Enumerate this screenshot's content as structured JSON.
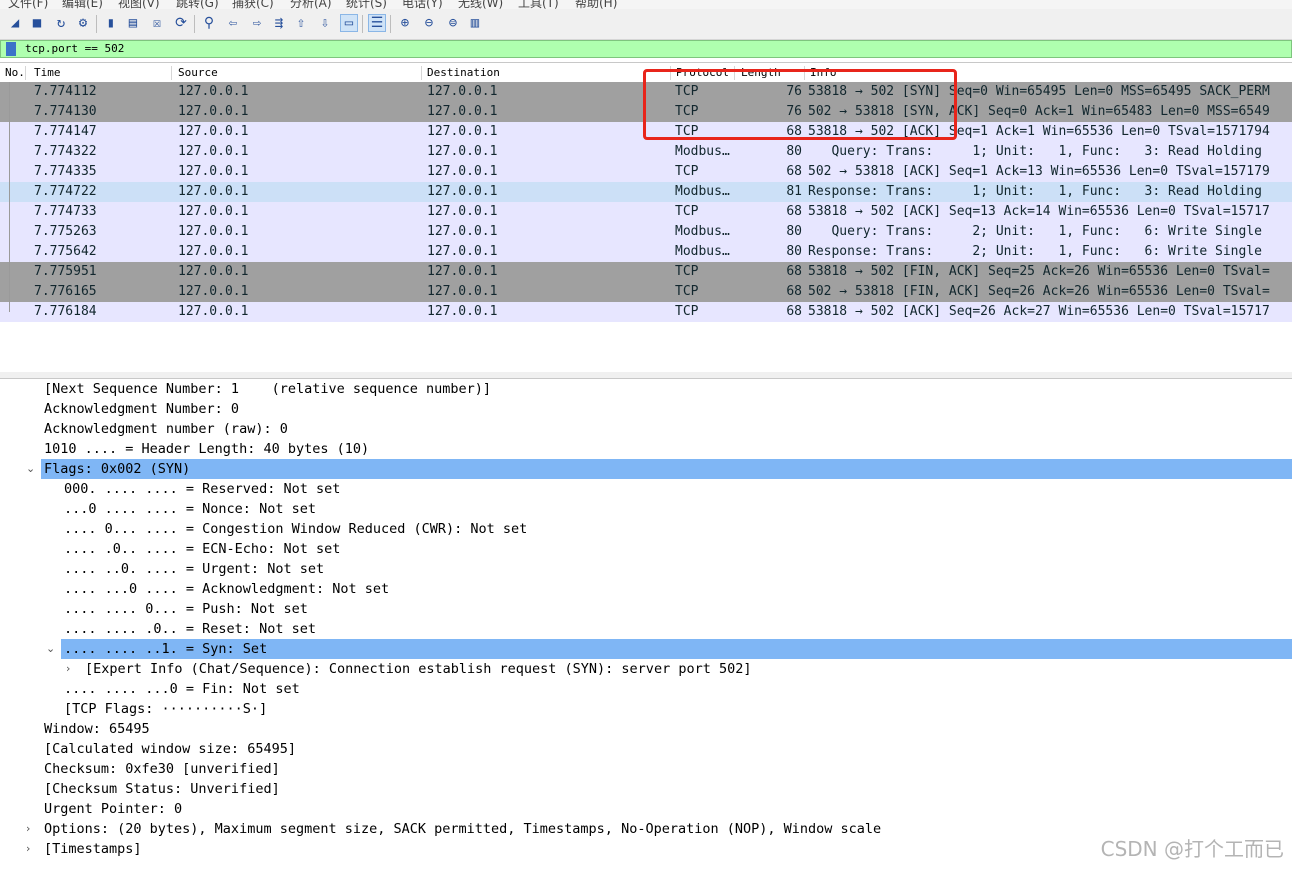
{
  "menu": [
    "文件(F)",
    "编辑(E)",
    "视图(V)",
    "跳转(G)",
    "捕获(C)",
    "分析(A)",
    "统计(S)",
    "电话(Y)",
    "无线(W)",
    "工具(T)",
    "帮助(H)"
  ],
  "toolbar": {
    "icons": [
      "shark-fin-start-icon",
      "stop-icon",
      "restart-icon",
      "options-gear-icon",
      "open-file-icon",
      "save-file-icon",
      "close-file-icon",
      "reload-icon",
      "find-icon",
      "back-arrow-icon",
      "forward-arrow-icon",
      "goto-packet-icon",
      "first-packet-icon",
      "last-packet-icon",
      "autoscroll-icon",
      "colorize-icon",
      "zoom-in-icon",
      "zoom-out-icon",
      "zoom-reset-icon",
      "resize-columns-icon"
    ]
  },
  "filter": {
    "value": "tcp.port == 502",
    "color": "#afffaf"
  },
  "packet_list": {
    "columns": [
      "No.",
      "Time",
      "Source",
      "Destination",
      "Protocol",
      "Length",
      "Info"
    ],
    "rows": [
      {
        "no": "",
        "time": "7.774112",
        "src": "127.0.0.1",
        "dst": "127.0.0.1",
        "proto": "TCP",
        "len": "76",
        "info": "53818 → 502 [SYN] Seq=0 Win=65495 Len=0 MSS=65495 SACK_PERM",
        "bg": "#a0a0a0"
      },
      {
        "no": "",
        "time": "7.774130",
        "src": "127.0.0.1",
        "dst": "127.0.0.1",
        "proto": "TCP",
        "len": "76",
        "info": "502 → 53818 [SYN, ACK] Seq=0 Ack=1 Win=65483 Len=0 MSS=6549",
        "bg": "#a0a0a0"
      },
      {
        "no": "",
        "time": "7.774147",
        "src": "127.0.0.1",
        "dst": "127.0.0.1",
        "proto": "TCP",
        "len": "68",
        "info": "53818 → 502 [ACK] Seq=1 Ack=1 Win=65536 Len=0 TSval=1571794",
        "bg": "#e7e6ff"
      },
      {
        "no": "",
        "time": "7.774322",
        "src": "127.0.0.1",
        "dst": "127.0.0.1",
        "proto": "Modbus…",
        "len": "80",
        "info": "   Query: Trans:     1; Unit:   1, Func:   3: Read Holding",
        "bg": "#e7e6ff"
      },
      {
        "no": "",
        "time": "7.774335",
        "src": "127.0.0.1",
        "dst": "127.0.0.1",
        "proto": "TCP",
        "len": "68",
        "info": "502 → 53818 [ACK] Seq=1 Ack=13 Win=65536 Len=0 TSval=157179",
        "bg": "#e7e6ff"
      },
      {
        "no": "",
        "time": "7.774722",
        "src": "127.0.0.1",
        "dst": "127.0.0.1",
        "proto": "Modbus…",
        "len": "81",
        "info": "Response: Trans:     1; Unit:   1, Func:   3: Read Holding",
        "bg": "#cce0f7"
      },
      {
        "no": "",
        "time": "7.774733",
        "src": "127.0.0.1",
        "dst": "127.0.0.1",
        "proto": "TCP",
        "len": "68",
        "info": "53818 → 502 [ACK] Seq=13 Ack=14 Win=65536 Len=0 TSval=15717",
        "bg": "#e7e6ff"
      },
      {
        "no": "",
        "time": "7.775263",
        "src": "127.0.0.1",
        "dst": "127.0.0.1",
        "proto": "Modbus…",
        "len": "80",
        "info": "   Query: Trans:     2; Unit:   1, Func:   6: Write Single",
        "bg": "#e7e6ff"
      },
      {
        "no": "",
        "time": "7.775642",
        "src": "127.0.0.1",
        "dst": "127.0.0.1",
        "proto": "Modbus…",
        "len": "80",
        "info": "Response: Trans:     2; Unit:   1, Func:   6: Write Single",
        "bg": "#e7e6ff"
      },
      {
        "no": "",
        "time": "7.775951",
        "src": "127.0.0.1",
        "dst": "127.0.0.1",
        "proto": "TCP",
        "len": "68",
        "info": "53818 → 502 [FIN, ACK] Seq=25 Ack=26 Win=65536 Len=0 TSval=",
        "bg": "#a0a0a0"
      },
      {
        "no": "",
        "time": "7.776165",
        "src": "127.0.0.1",
        "dst": "127.0.0.1",
        "proto": "TCP",
        "len": "68",
        "info": "502 → 53818 [FIN, ACK] Seq=26 Ack=26 Win=65536 Len=0 TSval=",
        "bg": "#a0a0a0"
      },
      {
        "no": "",
        "time": "7.776184",
        "src": "127.0.0.1",
        "dst": "127.0.0.1",
        "proto": "TCP",
        "len": "68",
        "info": "53818 → 502 [ACK] Seq=26 Ack=27 Win=65536 Len=0 TSval=15717",
        "bg": "#e7e6ff"
      }
    ]
  },
  "detail": {
    "lines": [
      {
        "text": "[Next Sequence Number: 1    (relative sequence number)]",
        "arrow": ""
      },
      {
        "text": "Acknowledgment Number: 0",
        "arrow": ""
      },
      {
        "text": "Acknowledgment number (raw): 0",
        "arrow": ""
      },
      {
        "text": "1010 .... = Header Length: 40 bytes (10)",
        "arrow": ""
      },
      {
        "text": "Flags: 0x002 (SYN)",
        "arrow": "down",
        "selected": true
      },
      {
        "text": "000. .... .... = Reserved: Not set",
        "arrow": "",
        "indent": 1
      },
      {
        "text": "...0 .... .... = Nonce: Not set",
        "arrow": "",
        "indent": 1
      },
      {
        "text": ".... 0... .... = Congestion Window Reduced (CWR): Not set",
        "arrow": "",
        "indent": 1
      },
      {
        "text": ".... .0.. .... = ECN-Echo: Not set",
        "arrow": "",
        "indent": 1
      },
      {
        "text": ".... ..0. .... = Urgent: Not set",
        "arrow": "",
        "indent": 1
      },
      {
        "text": ".... ...0 .... = Acknowledgment: Not set",
        "arrow": "",
        "indent": 1
      },
      {
        "text": ".... .... 0... = Push: Not set",
        "arrow": "",
        "indent": 1
      },
      {
        "text": ".... .... .0.. = Reset: Not set",
        "arrow": "",
        "indent": 1
      },
      {
        "text": ".... .... ..1. = Syn: Set",
        "arrow": "down",
        "indent": 1,
        "selected": true
      },
      {
        "text": "[Expert Info (Chat/Sequence): Connection establish request (SYN): server port 502]",
        "arrow": "right",
        "indent": 2
      },
      {
        "text": ".... .... ...0 = Fin: Not set",
        "arrow": "",
        "indent": 1
      },
      {
        "text": "[TCP Flags: ··········S·]",
        "arrow": "",
        "indent": 1
      },
      {
        "text": "Window: 65495",
        "arrow": ""
      },
      {
        "text": "[Calculated window size: 65495]",
        "arrow": ""
      },
      {
        "text": "Checksum: 0xfe30 [unverified]",
        "arrow": ""
      },
      {
        "text": "[Checksum Status: Unverified]",
        "arrow": ""
      },
      {
        "text": "Urgent Pointer: 0",
        "arrow": ""
      },
      {
        "text": "Options: (20 bytes), Maximum segment size, SACK permitted, Timestamps, No-Operation (NOP), Window scale",
        "arrow": "right"
      },
      {
        "text": "[Timestamps]",
        "arrow": "right"
      }
    ]
  },
  "watermark": "CSDN @打个工而已",
  "colors": {
    "highlight_box": "#e8251b",
    "selected_row": "#7fb6f5"
  }
}
